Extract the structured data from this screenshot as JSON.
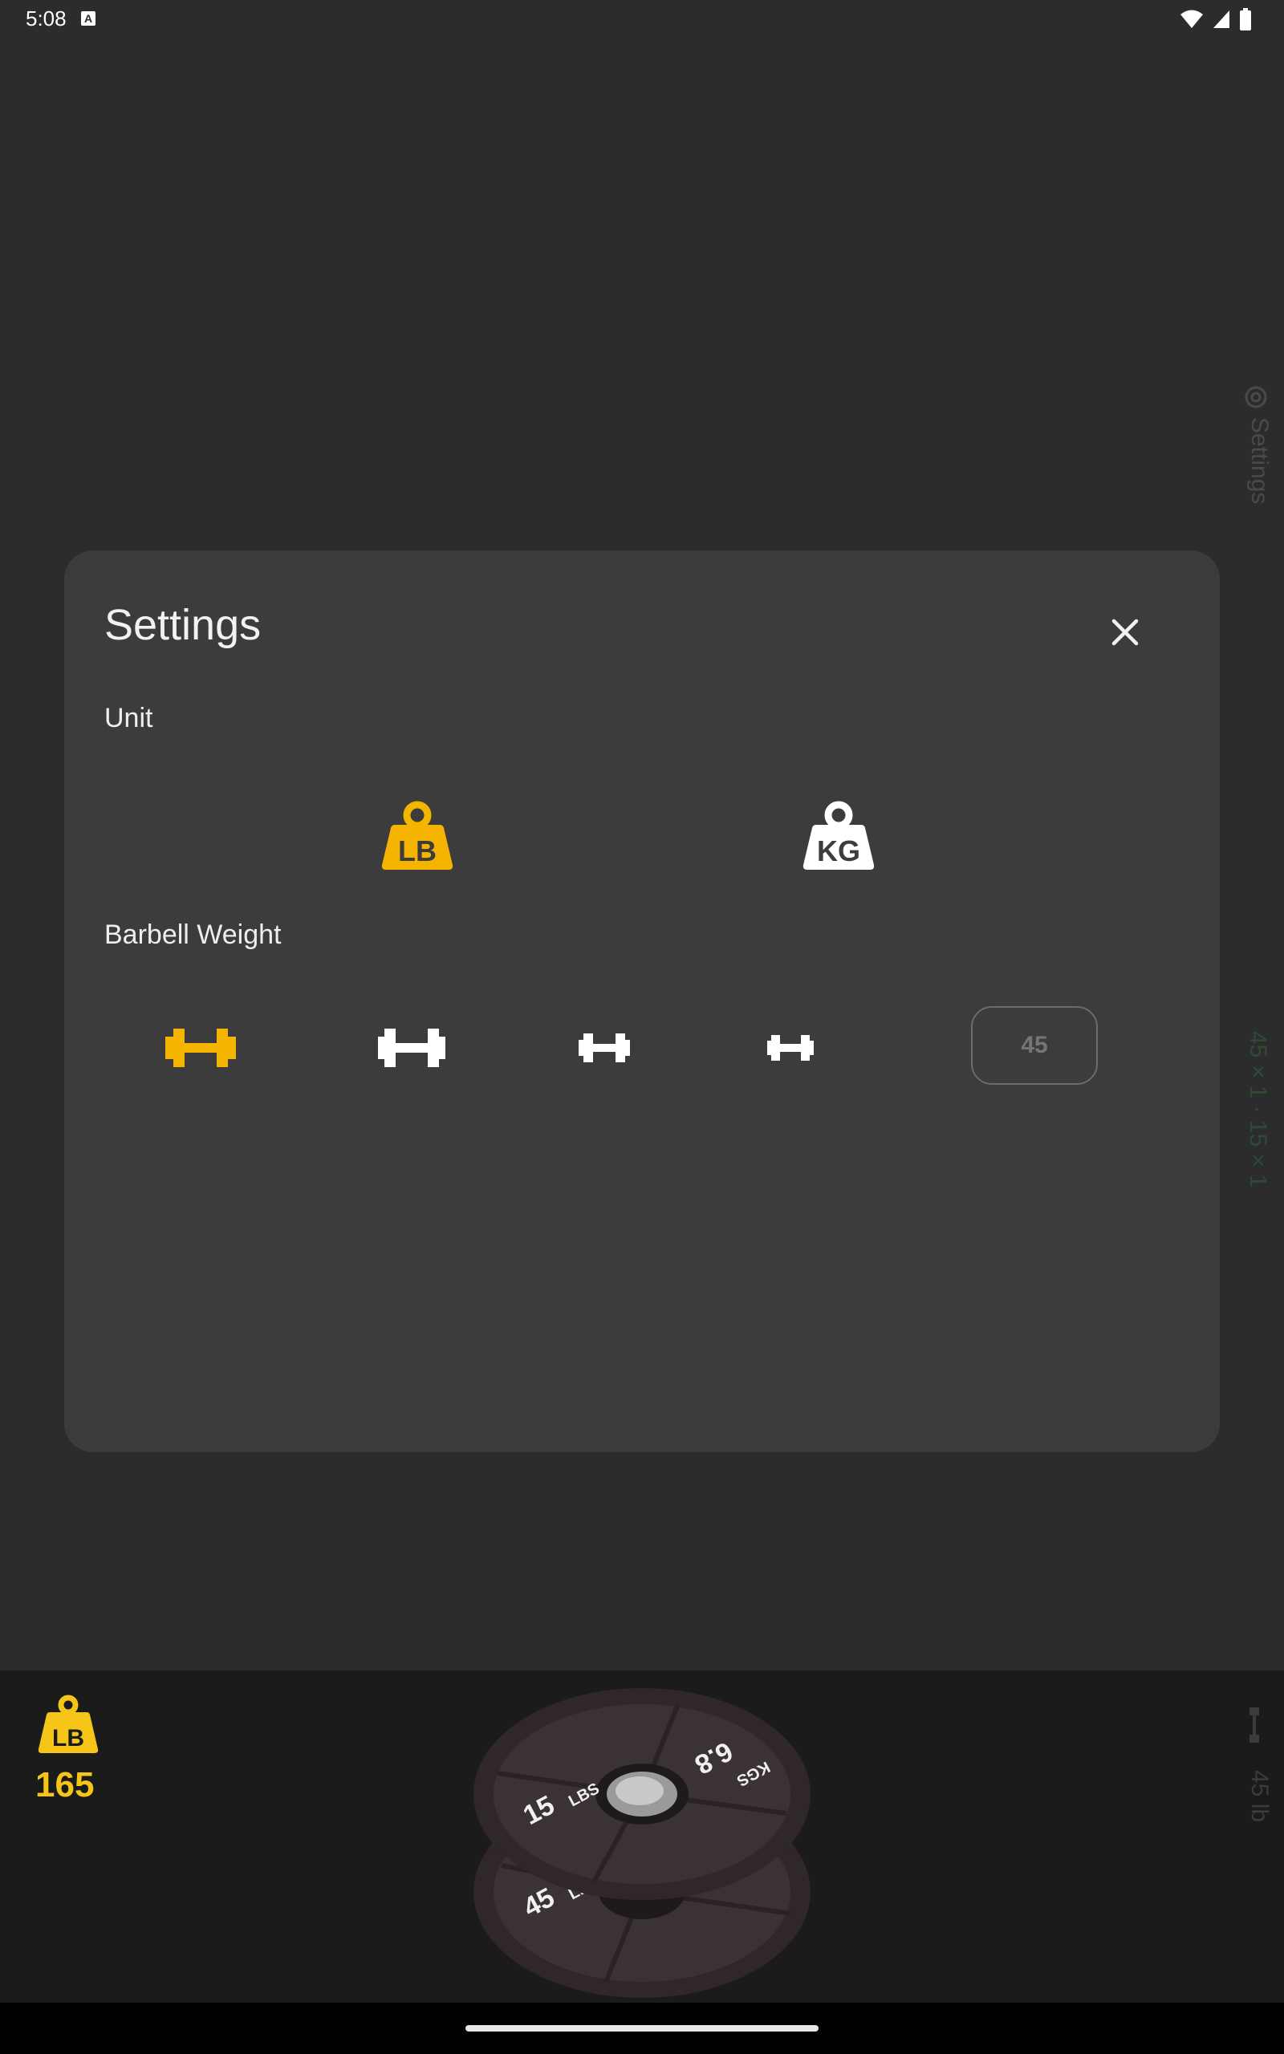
{
  "status_bar": {
    "time": "5:08",
    "notification_badge": "A"
  },
  "background": {
    "side_settings_label": "Settings",
    "side_plates_label": "45 × 1 · 15 × 1",
    "side_bar_weight_label": "45 lb"
  },
  "modal": {
    "title": "Settings",
    "unit_section_label": "Unit",
    "unit_options": [
      {
        "label": "LB",
        "selected": true
      },
      {
        "label": "KG",
        "selected": false
      }
    ],
    "barbell_section_label": "Barbell Weight",
    "barbell_options": [
      {
        "size": "large",
        "selected": true
      },
      {
        "size": "large",
        "selected": false
      },
      {
        "size": "medium",
        "selected": false
      },
      {
        "size": "small",
        "selected": false
      }
    ],
    "custom_weight_placeholder": "45"
  },
  "bottom": {
    "total_unit_icon": "LB",
    "total_weight": "165",
    "plates": [
      {
        "weight": "15",
        "unit": "LBS",
        "alt_weight": "6.8",
        "alt_unit": "KGS"
      },
      {
        "weight": "45",
        "unit": "LBS"
      }
    ]
  },
  "colors": {
    "accent": "#f5b400",
    "total_accent": "#f5c518",
    "modal_bg": "#3c3c3c",
    "page_bg": "#2c2c2e",
    "bottom_bg": "#1b1b1b"
  }
}
